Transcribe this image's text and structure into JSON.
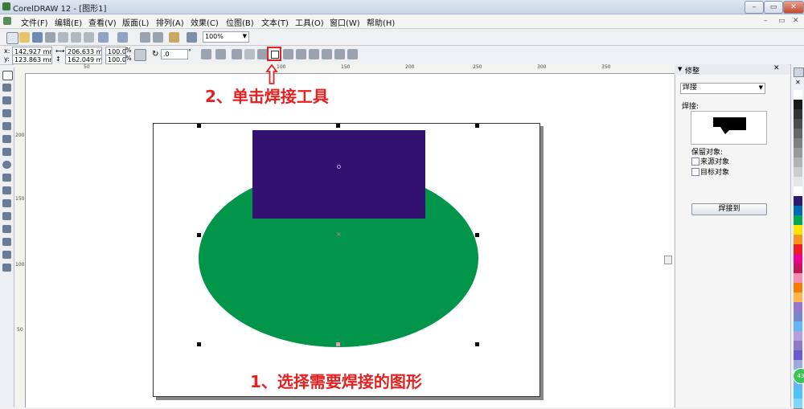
{
  "window": {
    "title": "CorelDRAW 12 - [图形1]"
  },
  "menu": [
    "文件(F)",
    "编辑(E)",
    "查看(V)",
    "版面(L)",
    "排列(A)",
    "效果(C)",
    "位图(B)",
    "文本(T)",
    "工具(O)",
    "窗口(W)",
    "帮助(H)"
  ],
  "toolbar": {
    "zoom": "100%"
  },
  "property_bar": {
    "x": "142.927 mm",
    "y": "123.863 mm",
    "width": "206.633 mr",
    "height": "162.049 mr",
    "scale_x": "100.0",
    "scale_y": "100.0",
    "pct1": "%",
    "pct2": "%",
    "rotation": ".0",
    "deg": "°"
  },
  "ruler": {
    "h_ticks": [
      "50",
      "100",
      "150",
      "200",
      "250",
      "300",
      "350"
    ],
    "v_ticks": [
      "200",
      "150",
      "100",
      "50"
    ]
  },
  "docker": {
    "tab": "修整",
    "dropdown": "焊接",
    "section_label": "焊接:",
    "keep_label": "保留对象:",
    "option_source": "来源对象",
    "option_target": "目标对象",
    "apply_button": "焊接到"
  },
  "annotations": {
    "step2": "2、单击焊接工具",
    "step1": "1、选择需要焊接的图形"
  },
  "colors": {
    "rectangle": "#321170",
    "ellipse": "#009549",
    "annotation": "#e42121",
    "palette": [
      "#ffffff",
      "#1a1a1a",
      "#333333",
      "#4d4d4d",
      "#666666",
      "#808080",
      "#999999",
      "#b3b3b3",
      "#cccccc",
      "#e6e6e6",
      "#ffffff",
      "#2b1a6e",
      "#0069b4",
      "#00a651",
      "#ffe500",
      "#f7941d",
      "#ed1c24",
      "#ec008c",
      "#c2185b",
      "#f48fb1",
      "#f57c00",
      "#ffb74d",
      "#9575cd",
      "#7986cb",
      "#64b5f6",
      "#b3a0d9",
      "#8e7cc3",
      "#6a5acd",
      "#9fa8da",
      "#bbdefb",
      "#64b5f6",
      "#4fc3f7",
      "#81d4fa"
    ]
  }
}
